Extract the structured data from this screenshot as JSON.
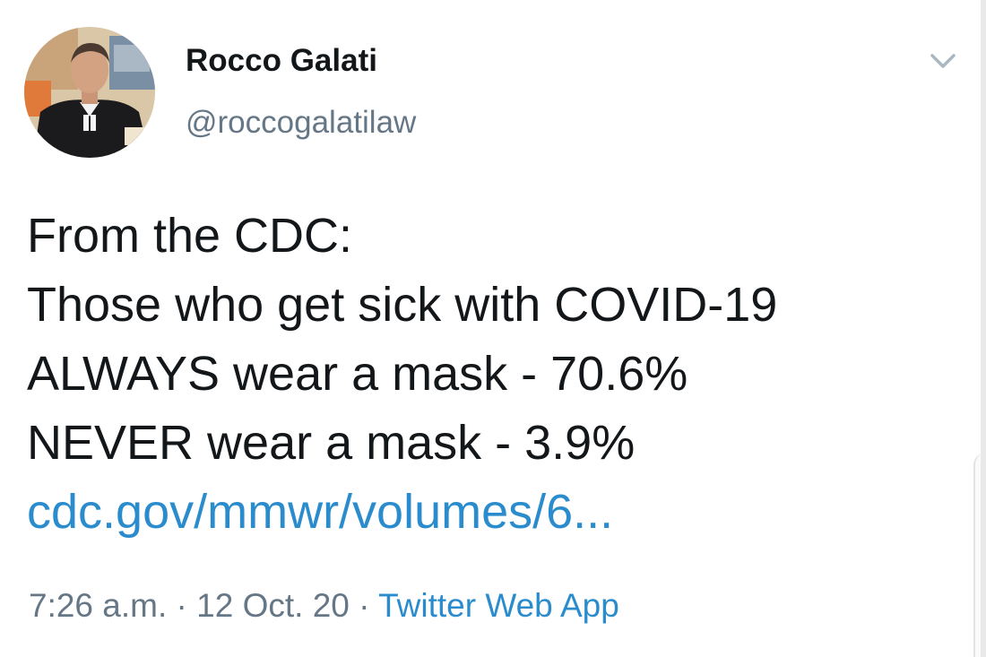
{
  "user": {
    "display_name": "Rocco Galati",
    "handle": "@roccogalatilaw",
    "avatar_icon": "profile-photo"
  },
  "menu": {
    "icon": "chevron-down-icon"
  },
  "tweet": {
    "lines": [
      "From the CDC:",
      "Those who get sick with COVID-19",
      "ALWAYS wear a mask - 70.6%",
      "NEVER wear a mask - 3.9%"
    ],
    "link_text": "cdc.gov/mmwr/volumes/6..."
  },
  "meta": {
    "time": "7:26 a.m.",
    "separator": "·",
    "date": "12 Oct. 20",
    "source": "Twitter Web App"
  },
  "colors": {
    "link": "#2a8ccd",
    "secondary_text": "#657786",
    "primary_text": "#14171a"
  }
}
